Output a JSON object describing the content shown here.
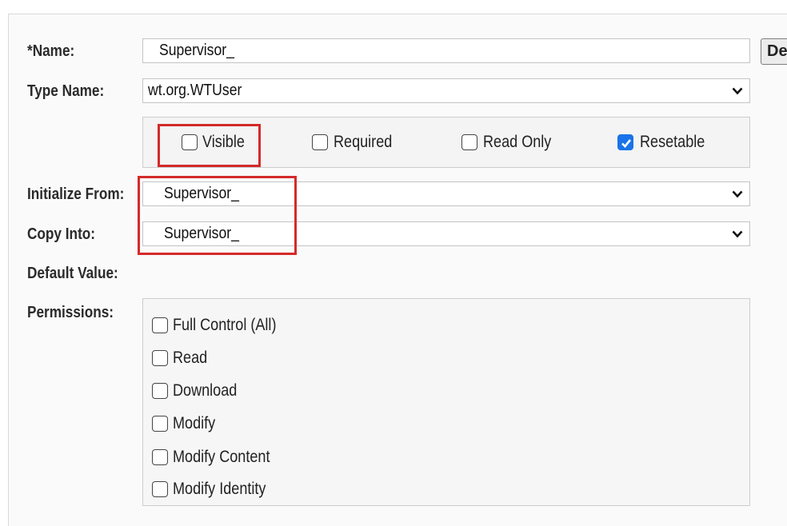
{
  "form": {
    "name_label": "*Name:",
    "name_value": "Supervisor_",
    "type_label": "Type Name:",
    "type_value": "wt.org.WTUser",
    "init_label": "Initialize From:",
    "init_value": "Supervisor_",
    "copy_label": "Copy Into:",
    "copy_value": "Supervisor_",
    "default_label": "Default Value:",
    "perm_label": "Permissions:",
    "button_label": "De"
  },
  "options": [
    {
      "label": "Visible",
      "checked": false
    },
    {
      "label": "Required",
      "checked": false
    },
    {
      "label": "Read Only",
      "checked": false
    },
    {
      "label": "Resetable",
      "checked": true
    }
  ],
  "permissions": [
    {
      "label": "Full Control (All)",
      "checked": false
    },
    {
      "label": "Read",
      "checked": false
    },
    {
      "label": "Download",
      "checked": false
    },
    {
      "label": "Modify",
      "checked": false
    },
    {
      "label": "Modify Content",
      "checked": false
    },
    {
      "label": "Modify Identity",
      "checked": false
    }
  ],
  "colors": {
    "highlight": "#d42a2a",
    "checked": "#1a73e8"
  },
  "icons": [
    "chevron-down-icon",
    "check-icon"
  ]
}
